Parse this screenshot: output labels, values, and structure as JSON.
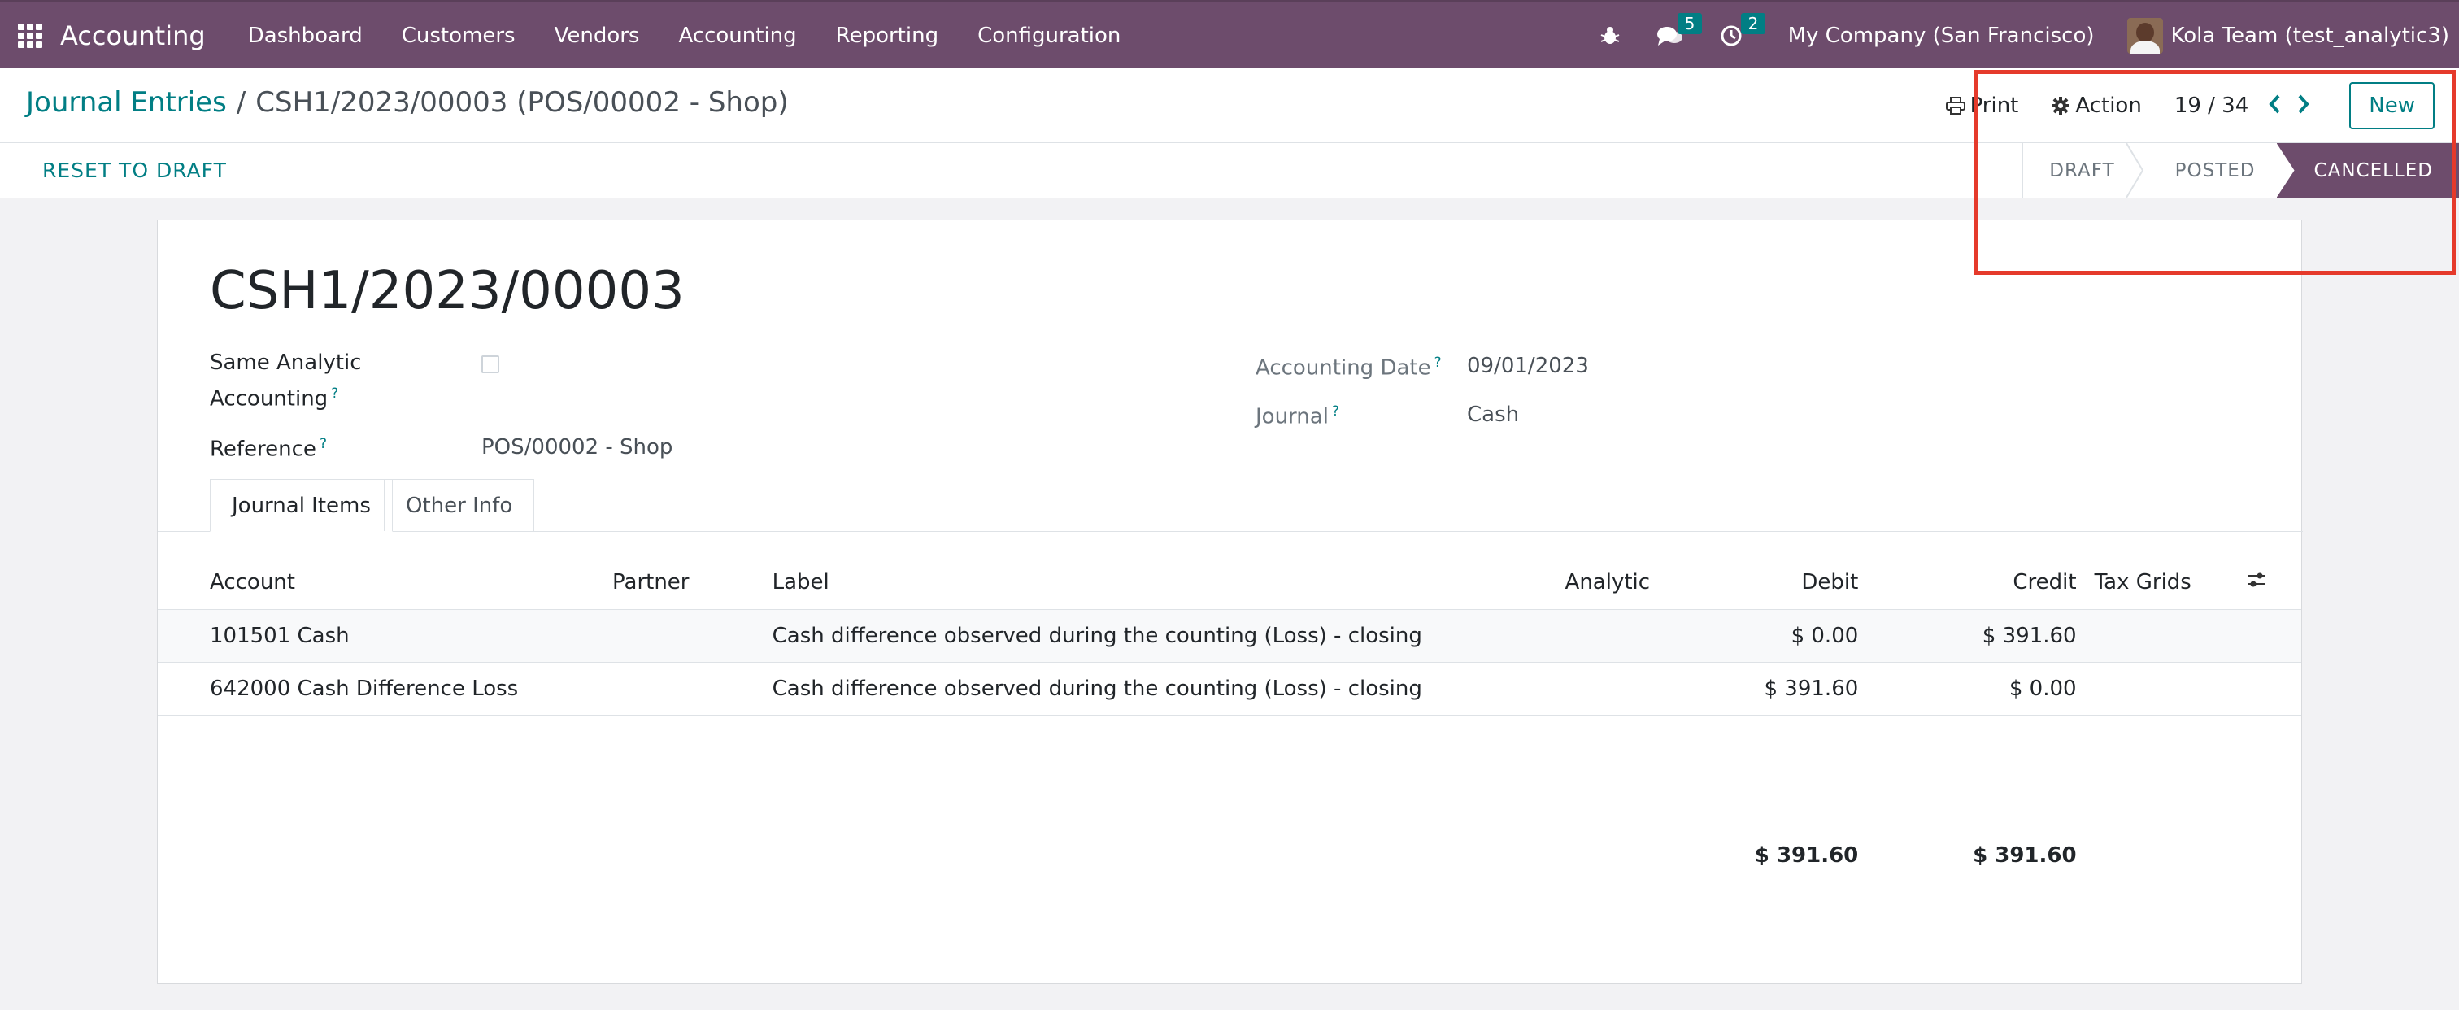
{
  "navbar": {
    "brand": "Accounting",
    "menu": [
      "Dashboard",
      "Customers",
      "Vendors",
      "Accounting",
      "Reporting",
      "Configuration"
    ],
    "messages_badge": "5",
    "activities_badge": "2",
    "company": "My Company (San Francisco)",
    "user": "Kola Team (test_analytic3)"
  },
  "breadcrumb": {
    "parent": "Journal Entries",
    "separator": "/",
    "current": "CSH1/2023/00003 (POS/00002 - Shop)"
  },
  "control": {
    "print_label": "Print",
    "action_label": "Action",
    "pager": "19 / 34",
    "new_label": "New"
  },
  "statusbar": {
    "reset_label": "RESET TO DRAFT",
    "stages": [
      "DRAFT",
      "POSTED",
      "CANCELLED"
    ],
    "active_stage": "CANCELLED"
  },
  "form": {
    "title": "CSH1/2023/00003",
    "same_analytic_label_1": "Same Analytic",
    "same_analytic_label_2": "Accounting",
    "same_analytic_checked": false,
    "reference_label": "Reference",
    "reference_value": "POS/00002 - Shop",
    "accounting_date_label": "Accounting Date",
    "accounting_date_value": "09/01/2023",
    "journal_label": "Journal",
    "journal_value": "Cash",
    "help_mark": "?"
  },
  "tabs": [
    "Journal Items",
    "Other Info"
  ],
  "table": {
    "headers": [
      "Account",
      "Partner",
      "Label",
      "Analytic",
      "Debit",
      "Credit",
      "Tax Grids"
    ],
    "rows": [
      {
        "account": "101501 Cash",
        "partner": "",
        "label": "Cash difference observed during the counting (Loss) - closing",
        "analytic": "",
        "debit": "$ 0.00",
        "credit": "$ 391.60",
        "tax": ""
      },
      {
        "account": "642000 Cash Difference Loss",
        "partner": "",
        "label": "Cash difference observed during the counting (Loss) - closing",
        "analytic": "",
        "debit": "$ 391.60",
        "credit": "$ 0.00",
        "tax": ""
      }
    ],
    "total_debit": "$ 391.60",
    "total_credit": "$ 391.60"
  },
  "colors": {
    "navbar": "#6d4c6c",
    "accent": "#017e84",
    "highlight": "#e53a2b"
  }
}
